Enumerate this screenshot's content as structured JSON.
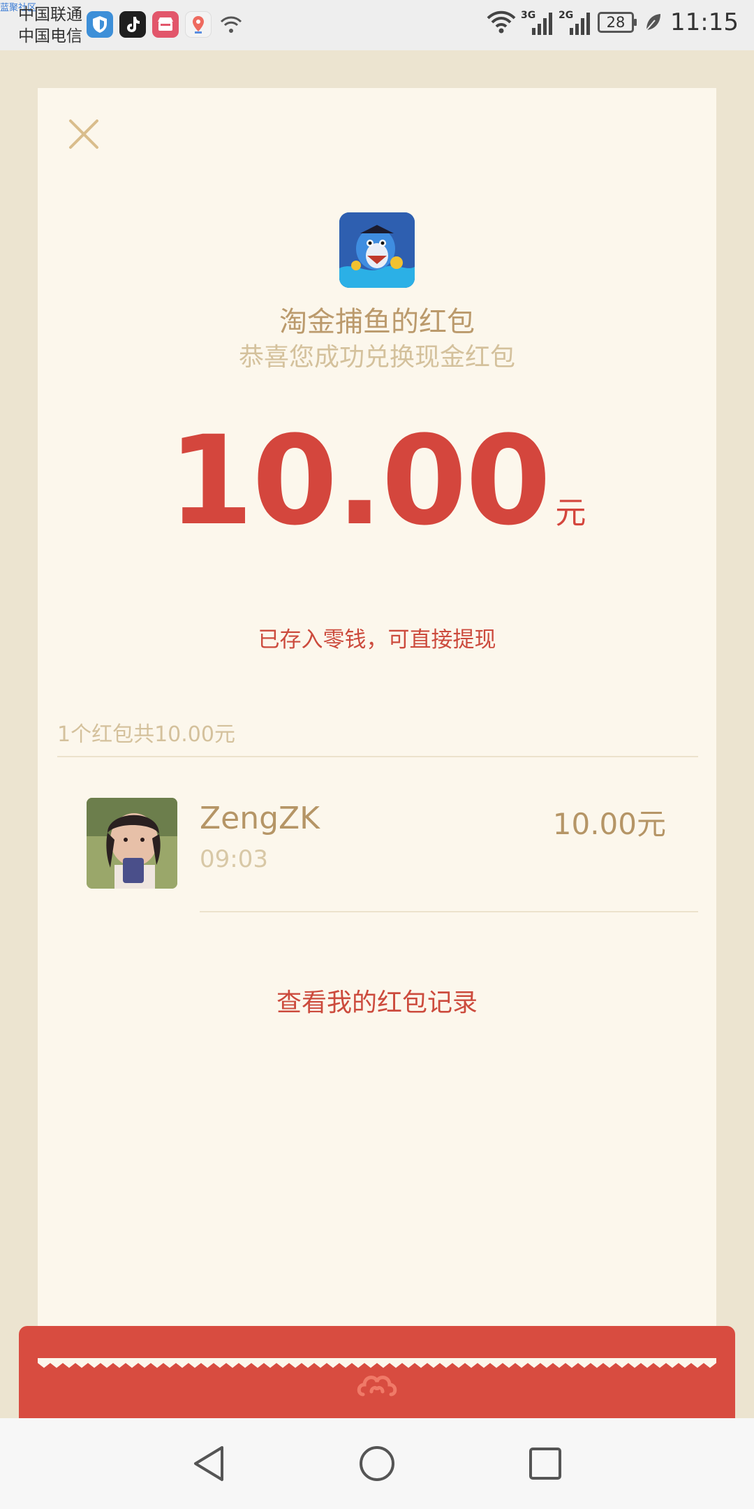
{
  "status_bar": {
    "watermark": "蓝聚社区",
    "carrier_1": "中国联通",
    "carrier_2": "中国电信",
    "sim1_type": "3G",
    "sim2_type": "2G",
    "battery": "28",
    "time": "11:15",
    "app_icons": [
      "shield-icon",
      "tiktok-icon",
      "shop-icon",
      "map-pin-icon",
      "wifi-question-icon"
    ]
  },
  "packet": {
    "title": "淘金捕鱼的红包",
    "subtitle": "恭喜您成功兑换现金红包",
    "amount": "10.00",
    "unit": "元",
    "note": "已存入零钱，可直接提现",
    "summary": "1个红包共10.00元"
  },
  "records": [
    {
      "name": "ZengZK",
      "time": "09:03",
      "amount": "10.00元"
    }
  ],
  "links": {
    "view_records": "查看我的红包记录"
  },
  "colors": {
    "accent_red": "#d4463d",
    "gold_text": "#b59566",
    "card_bg": "#fcf7ec",
    "page_bg": "#ece4d0"
  }
}
